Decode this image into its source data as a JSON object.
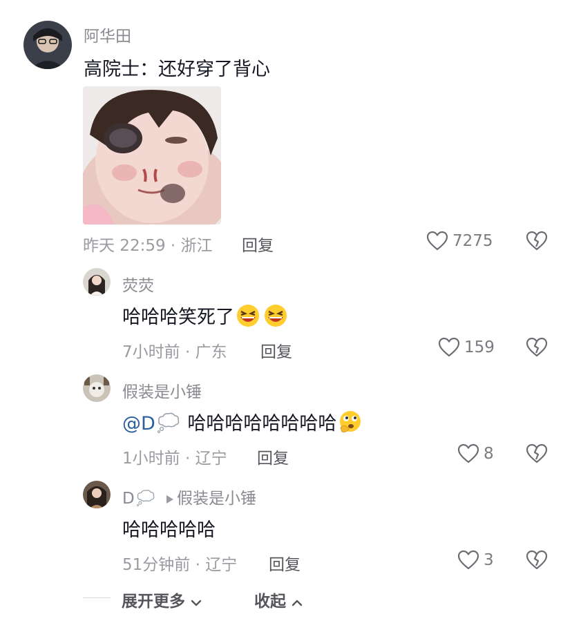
{
  "comments": [
    {
      "username": "阿华田",
      "text": "高院士：还好穿了背心",
      "time_location": "昨天 22:59 · 浙江",
      "reply_label": "回复",
      "likes": "7275"
    },
    {
      "username": "荧荧",
      "text": "哈哈哈笑死了",
      "time_location": "7小时前 · 广东",
      "reply_label": "回复",
      "likes": "159"
    },
    {
      "username": "假装是小锤",
      "mention": "@D",
      "text": "哈哈哈哈哈哈哈哈",
      "time_location": "1小时前 · 辽宁",
      "reply_label": "回复",
      "likes": "8"
    },
    {
      "username": "D",
      "reply_to": "假装是小锤",
      "text": "哈哈哈哈哈",
      "time_location": "51分钟前 · 辽宁",
      "reply_label": "回复",
      "likes": "3"
    }
  ],
  "footer": {
    "expand_label": "展开更多",
    "collapse_label": "收起"
  }
}
